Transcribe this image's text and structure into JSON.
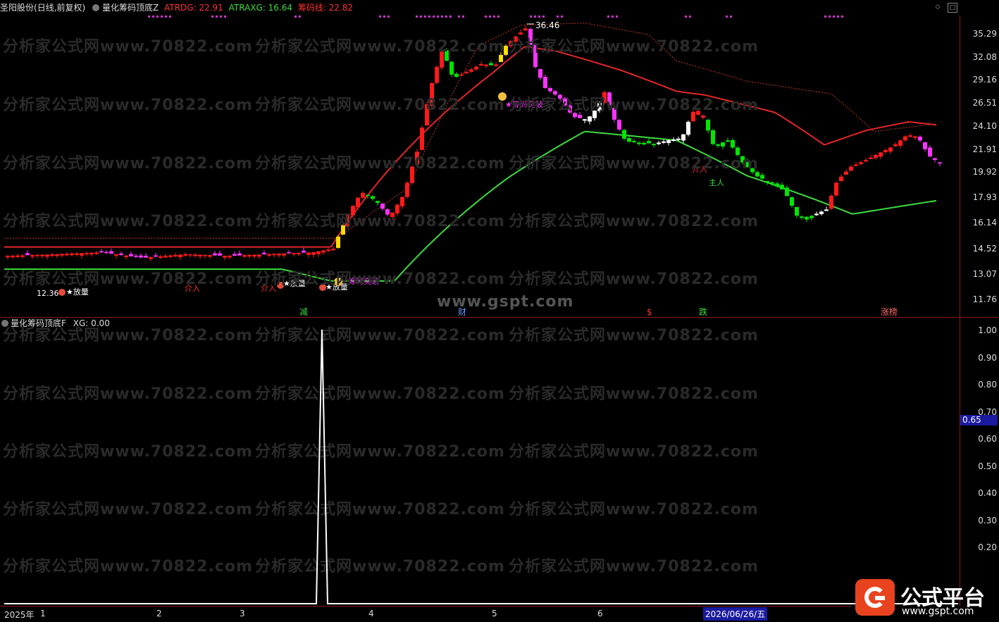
{
  "header": {
    "stock": "圣阳股份",
    "period": "(日线,前复权)",
    "indicator": "量化筹码顶底Z",
    "atrdg_label": "ATRDG: 22.91",
    "atraxg_label": "ATRAXG: 16.64",
    "chip_label": "筹码线: 22.82"
  },
  "subpanel": {
    "indicator": "量化筹码顶底F",
    "xg_label": "XG: 0.00",
    "cursor_value": "0.65"
  },
  "price_axis": [
    "35.29",
    "32.08",
    "29.16",
    "26.51",
    "24.10",
    "21.91",
    "19.92",
    "17.93",
    "16.14",
    "14.52",
    "13.07",
    "11.76"
  ],
  "sub_axis": [
    "1.00",
    "0.90",
    "0.80",
    "0.70",
    "0.60",
    "0.50",
    "0.40",
    "0.30",
    "0.20"
  ],
  "time_axis": {
    "year": "2025年",
    "months": [
      "1",
      "2",
      "3",
      "4",
      "5",
      "6"
    ],
    "cursor_date": "2026/06/26/五"
  },
  "annotations": {
    "high": "36.46",
    "low": "12.36",
    "chip_break_1": "筹码突破",
    "chip_break_2": "★筹码突破",
    "volume_1": "★放量",
    "volume_2": "★放量",
    "volume_3": "★放量",
    "buy_1": "介入",
    "buy_2": "介入",
    "buy_3": "介入",
    "buy_4": "主人",
    "event_1": "减",
    "event_2": "财",
    "event_3": "$",
    "event_4": "跌",
    "event_5": "涨",
    "event_6": "榜"
  },
  "watermarks": {
    "site": "分析家公式网www.70822.com",
    "gspt": "www.gspt.com"
  },
  "ad": {
    "title": "公式平台",
    "url": "www.gspt.com"
  },
  "colors": {
    "up": "#ff1a1a",
    "down": "#00e600",
    "magenta": "#ff33ff",
    "yellow": "#ffdd00",
    "upper_band": "#e32626",
    "lower_band": "#3ddc3d",
    "grid": "#8b1a1a"
  }
}
